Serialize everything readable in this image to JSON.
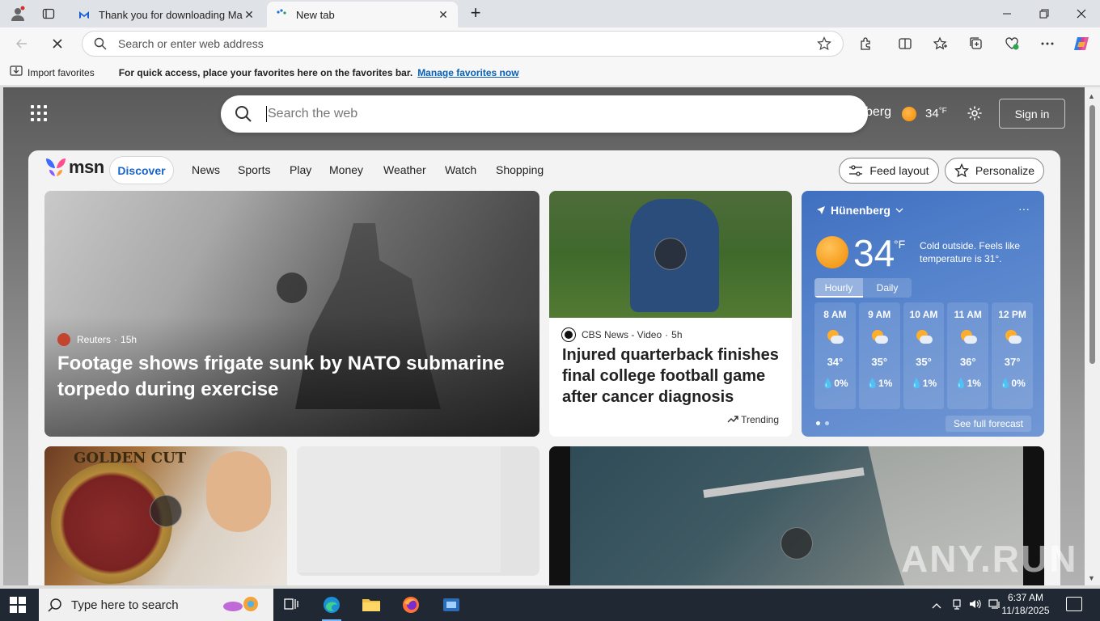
{
  "browser": {
    "tabs": [
      {
        "title": "Thank you for downloading Malw",
        "active": false,
        "favicon": "malwarebytes-icon"
      },
      {
        "title": "New tab",
        "active": true,
        "favicon": "edge-newtab-icon"
      }
    ],
    "new_tab_symbol": "+",
    "address_placeholder": "Search or enter web address",
    "favorites_bar": {
      "import_label": "Import favorites",
      "message": "For quick access, place your favorites here on the favorites bar.",
      "link": "Manage favorites now"
    }
  },
  "msn": {
    "search_placeholder": "Search the web",
    "header_location": "berg",
    "header_temp": "34",
    "header_unit": "°F",
    "sign_in": "Sign in",
    "logo_text": "msn",
    "nav": [
      "Discover",
      "News",
      "Sports",
      "Play",
      "Money",
      "Weather",
      "Watch",
      "Shopping"
    ],
    "feed_layout": "Feed layout",
    "personalize": "Personalize",
    "hero": {
      "source": "Reuters",
      "age": "15h",
      "title": "Footage shows frigate sunk by NATO submarine torpedo during exercise"
    },
    "story2": {
      "source": "CBS News - Video",
      "age": "5h",
      "title": "Injured quarterback finishes final college football game after cancer diagnosis",
      "trending": "Trending"
    },
    "card4_text": "GOLDEN CUT",
    "weather": {
      "location": "Hünenberg",
      "temp": "34",
      "unit": "°F",
      "note": "Cold outside. Feels like temperature is 31°.",
      "tabs": [
        "Hourly",
        "Daily"
      ],
      "hours": [
        {
          "time": "8 AM",
          "temp": "34°",
          "precip": "0%"
        },
        {
          "time": "9 AM",
          "temp": "35°",
          "precip": "1%"
        },
        {
          "time": "10 AM",
          "temp": "35°",
          "precip": "1%"
        },
        {
          "time": "11 AM",
          "temp": "36°",
          "precip": "1%"
        },
        {
          "time": "12 PM",
          "temp": "37°",
          "precip": "0%"
        }
      ],
      "full_forecast": "See full forecast"
    },
    "watermark": "ANY.RUN"
  },
  "taskbar": {
    "search_placeholder": "Type here to search",
    "time": "6:37 AM",
    "date": "11/18/2025"
  },
  "colors": {
    "accent": "#1a64c8",
    "weather_card": "#4a78c6",
    "taskbar": "#1f2833"
  }
}
